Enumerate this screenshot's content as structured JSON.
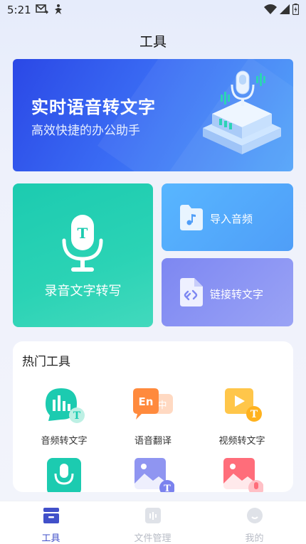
{
  "status": {
    "time": "5:21"
  },
  "header": {
    "title": "工具"
  },
  "banner": {
    "title": "实时语音转文字",
    "subtitle": "高效快捷的办公助手"
  },
  "cards": {
    "record": {
      "label": "录音文字转写",
      "glyph": "T"
    },
    "import": {
      "label": "导入音频"
    },
    "link": {
      "label": "链接转文字"
    }
  },
  "hot": {
    "title": "热门工具",
    "items": [
      {
        "label": "音频转文字",
        "icon": "audio-to-text-icon"
      },
      {
        "label": "语音翻译",
        "icon": "voice-translate-icon",
        "badge_en": "En",
        "badge_cn": "中"
      },
      {
        "label": "视频转文字",
        "icon": "video-to-text-icon"
      },
      {
        "label": "",
        "icon": "mic-green-icon"
      },
      {
        "label": "",
        "icon": "image-to-text-icon"
      },
      {
        "label": "",
        "icon": "image-voice-icon"
      }
    ]
  },
  "tabbar": {
    "items": [
      {
        "label": "工具",
        "active": true
      },
      {
        "label": "文件管理",
        "active": false
      },
      {
        "label": "我的",
        "active": false
      }
    ]
  },
  "colors": {
    "accent": "#4150c9",
    "teal": "#1ccbb0",
    "blue": "#3a6cf4"
  }
}
